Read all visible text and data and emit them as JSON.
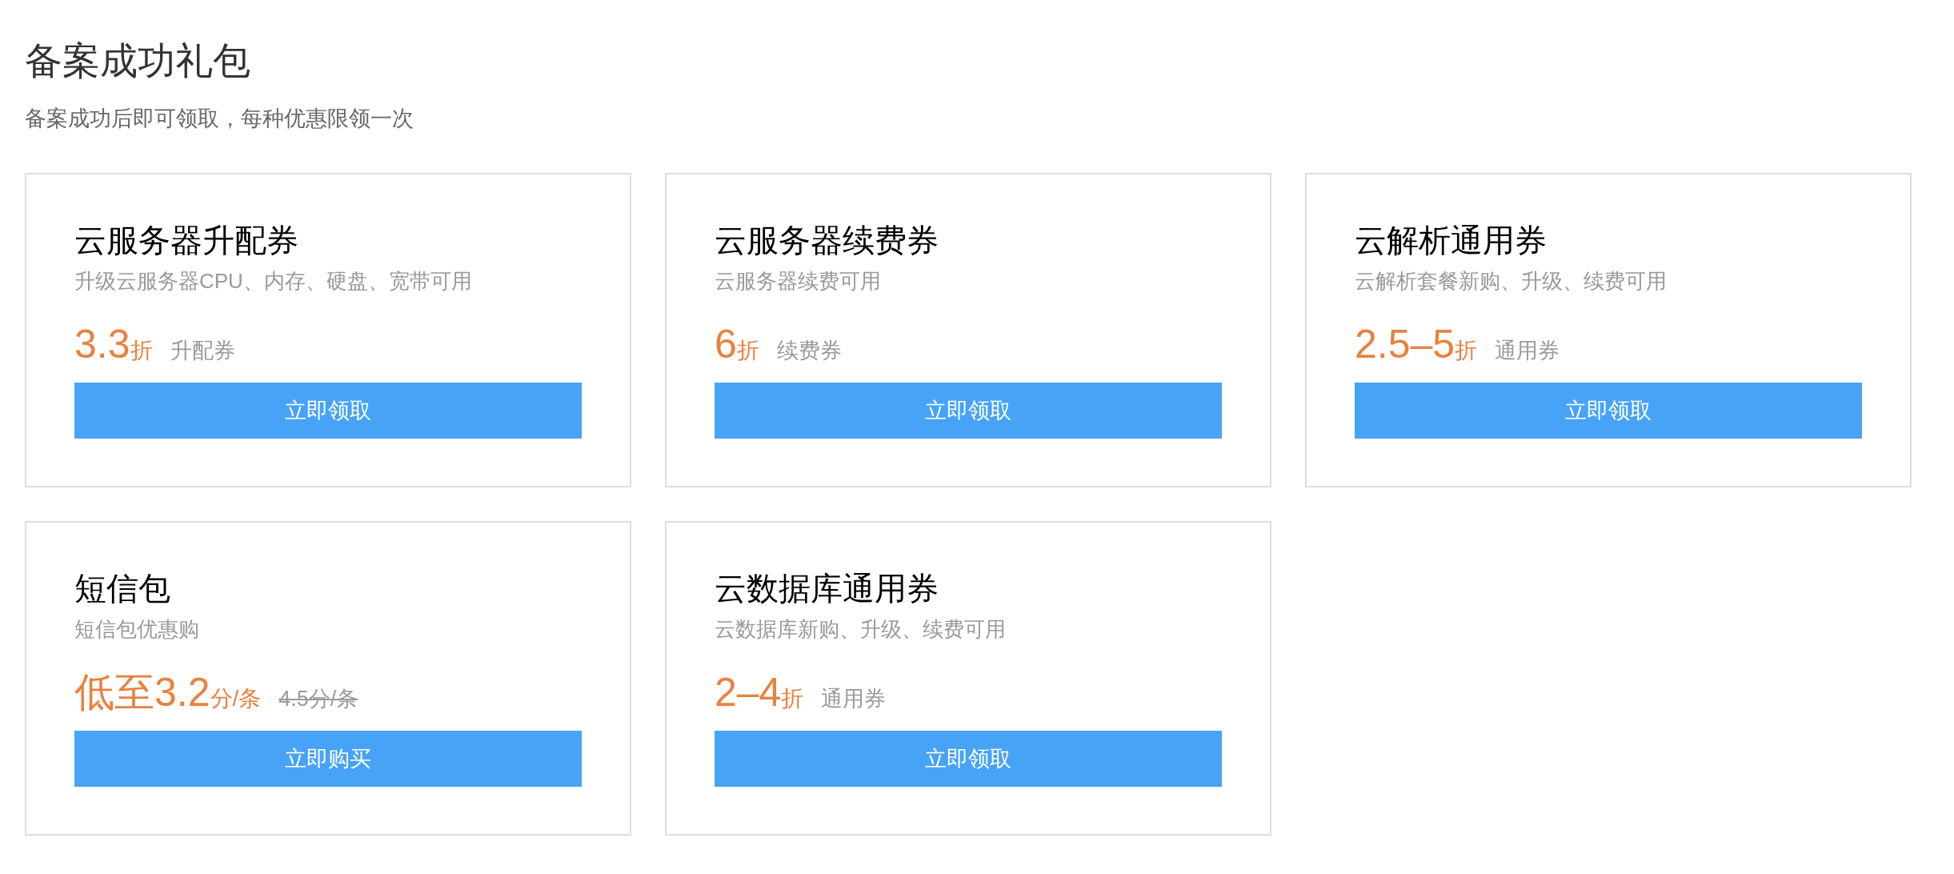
{
  "page": {
    "title": "备案成功礼包",
    "subtitle": "备案成功后即可领取，每种优惠限领一次"
  },
  "cards": [
    {
      "title": "云服务器升配券",
      "description": "升级云服务器CPU、内存、硬盘、宽带可用",
      "price": "3.3",
      "unit": "折",
      "note": "升配券",
      "note_struck": false,
      "button": "立即领取"
    },
    {
      "title": "云服务器续费券",
      "description": "云服务器续费可用",
      "price": "6",
      "unit": "折",
      "note": "续费券",
      "note_struck": false,
      "button": "立即领取"
    },
    {
      "title": "云解析通用券",
      "description": "云解析套餐新购、升级、续费可用",
      "price": "2.5–5",
      "unit": "折",
      "note": "通用券",
      "note_struck": false,
      "button": "立即领取"
    },
    {
      "title": "短信包",
      "description": "短信包优惠购",
      "price": "低至3.2",
      "unit": "分/条",
      "note": "4.5分/条",
      "note_struck": true,
      "button": "立即购买"
    },
    {
      "title": "云数据库通用券",
      "description": "云数据库新购、升级、续费可用",
      "price": "2–4",
      "unit": "折",
      "note": "通用券",
      "note_struck": false,
      "button": "立即领取"
    }
  ]
}
